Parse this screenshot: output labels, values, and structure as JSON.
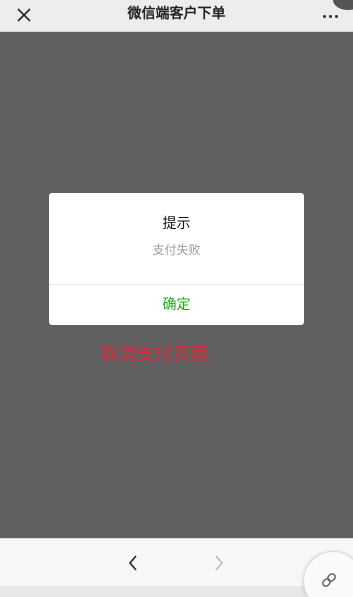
{
  "header": {
    "title": "微信端客户下单",
    "close_icon": "close-icon",
    "more_icon": "more-icon"
  },
  "dialog": {
    "title": "提示",
    "message": "支付失败",
    "confirm_label": "确定",
    "confirm_color": "#1aad19"
  },
  "annotation": {
    "text": "取消支付页面",
    "color": "#e0263a"
  },
  "bottom_nav": {
    "back_icon": "chevron-left-icon",
    "forward_icon": "chevron-right-icon",
    "link_icon": "link-icon"
  }
}
